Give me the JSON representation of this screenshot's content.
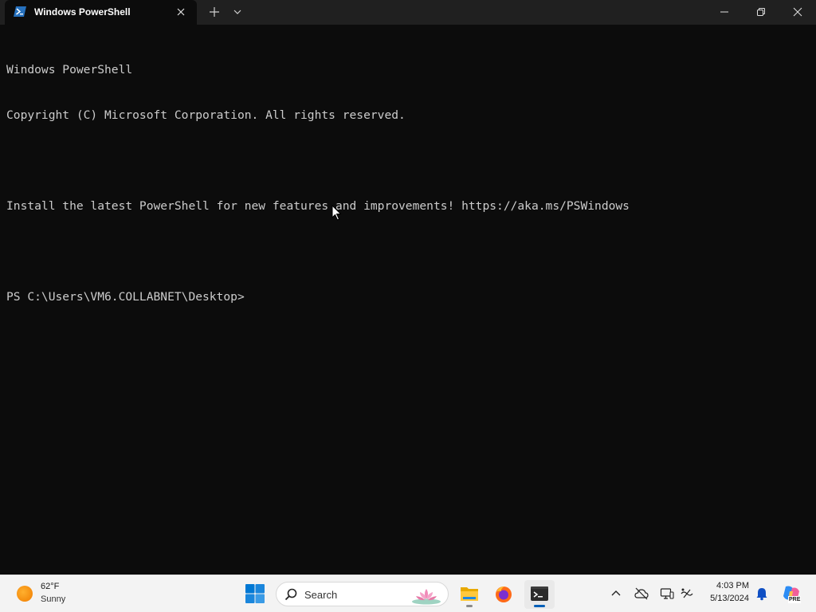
{
  "window": {
    "tab_title": "Windows PowerShell",
    "icons": {
      "tab": "powershell-icon",
      "close_tab": "close-icon",
      "new_tab": "plus-icon",
      "dropdown": "chevron-down-icon",
      "minimize": "minimize-icon",
      "maximize": "restore-icon",
      "close": "close-icon"
    }
  },
  "terminal": {
    "lines": [
      "Windows PowerShell",
      "Copyright (C) Microsoft Corporation. All rights reserved.",
      "",
      "Install the latest PowerShell for new features and improvements! https://aka.ms/PSWindows",
      "",
      "PS C:\\Users\\VM6.COLLABNET\\Desktop>"
    ],
    "background": "#0c0c0c",
    "foreground": "#cccccc"
  },
  "taskbar": {
    "weather": {
      "temp": "62°F",
      "condition": "Sunny",
      "icon": "sun-icon"
    },
    "search_placeholder": "Search",
    "apps": [
      {
        "name": "File Explorer",
        "icon": "folder-icon",
        "active": false
      },
      {
        "name": "Firefox",
        "icon": "firefox-icon",
        "active": false
      },
      {
        "name": "Terminal",
        "icon": "terminal-icon",
        "active": true
      }
    ],
    "tray": [
      "chevron-up-icon",
      "onedrive-icon",
      "display-icon",
      "network-icon"
    ],
    "clock": {
      "time": "4:03 PM",
      "date": "5/13/2024"
    },
    "notification_icon": "bell-icon",
    "copilot_icon": "copilot-icon",
    "copilot_badge": "PRE"
  }
}
